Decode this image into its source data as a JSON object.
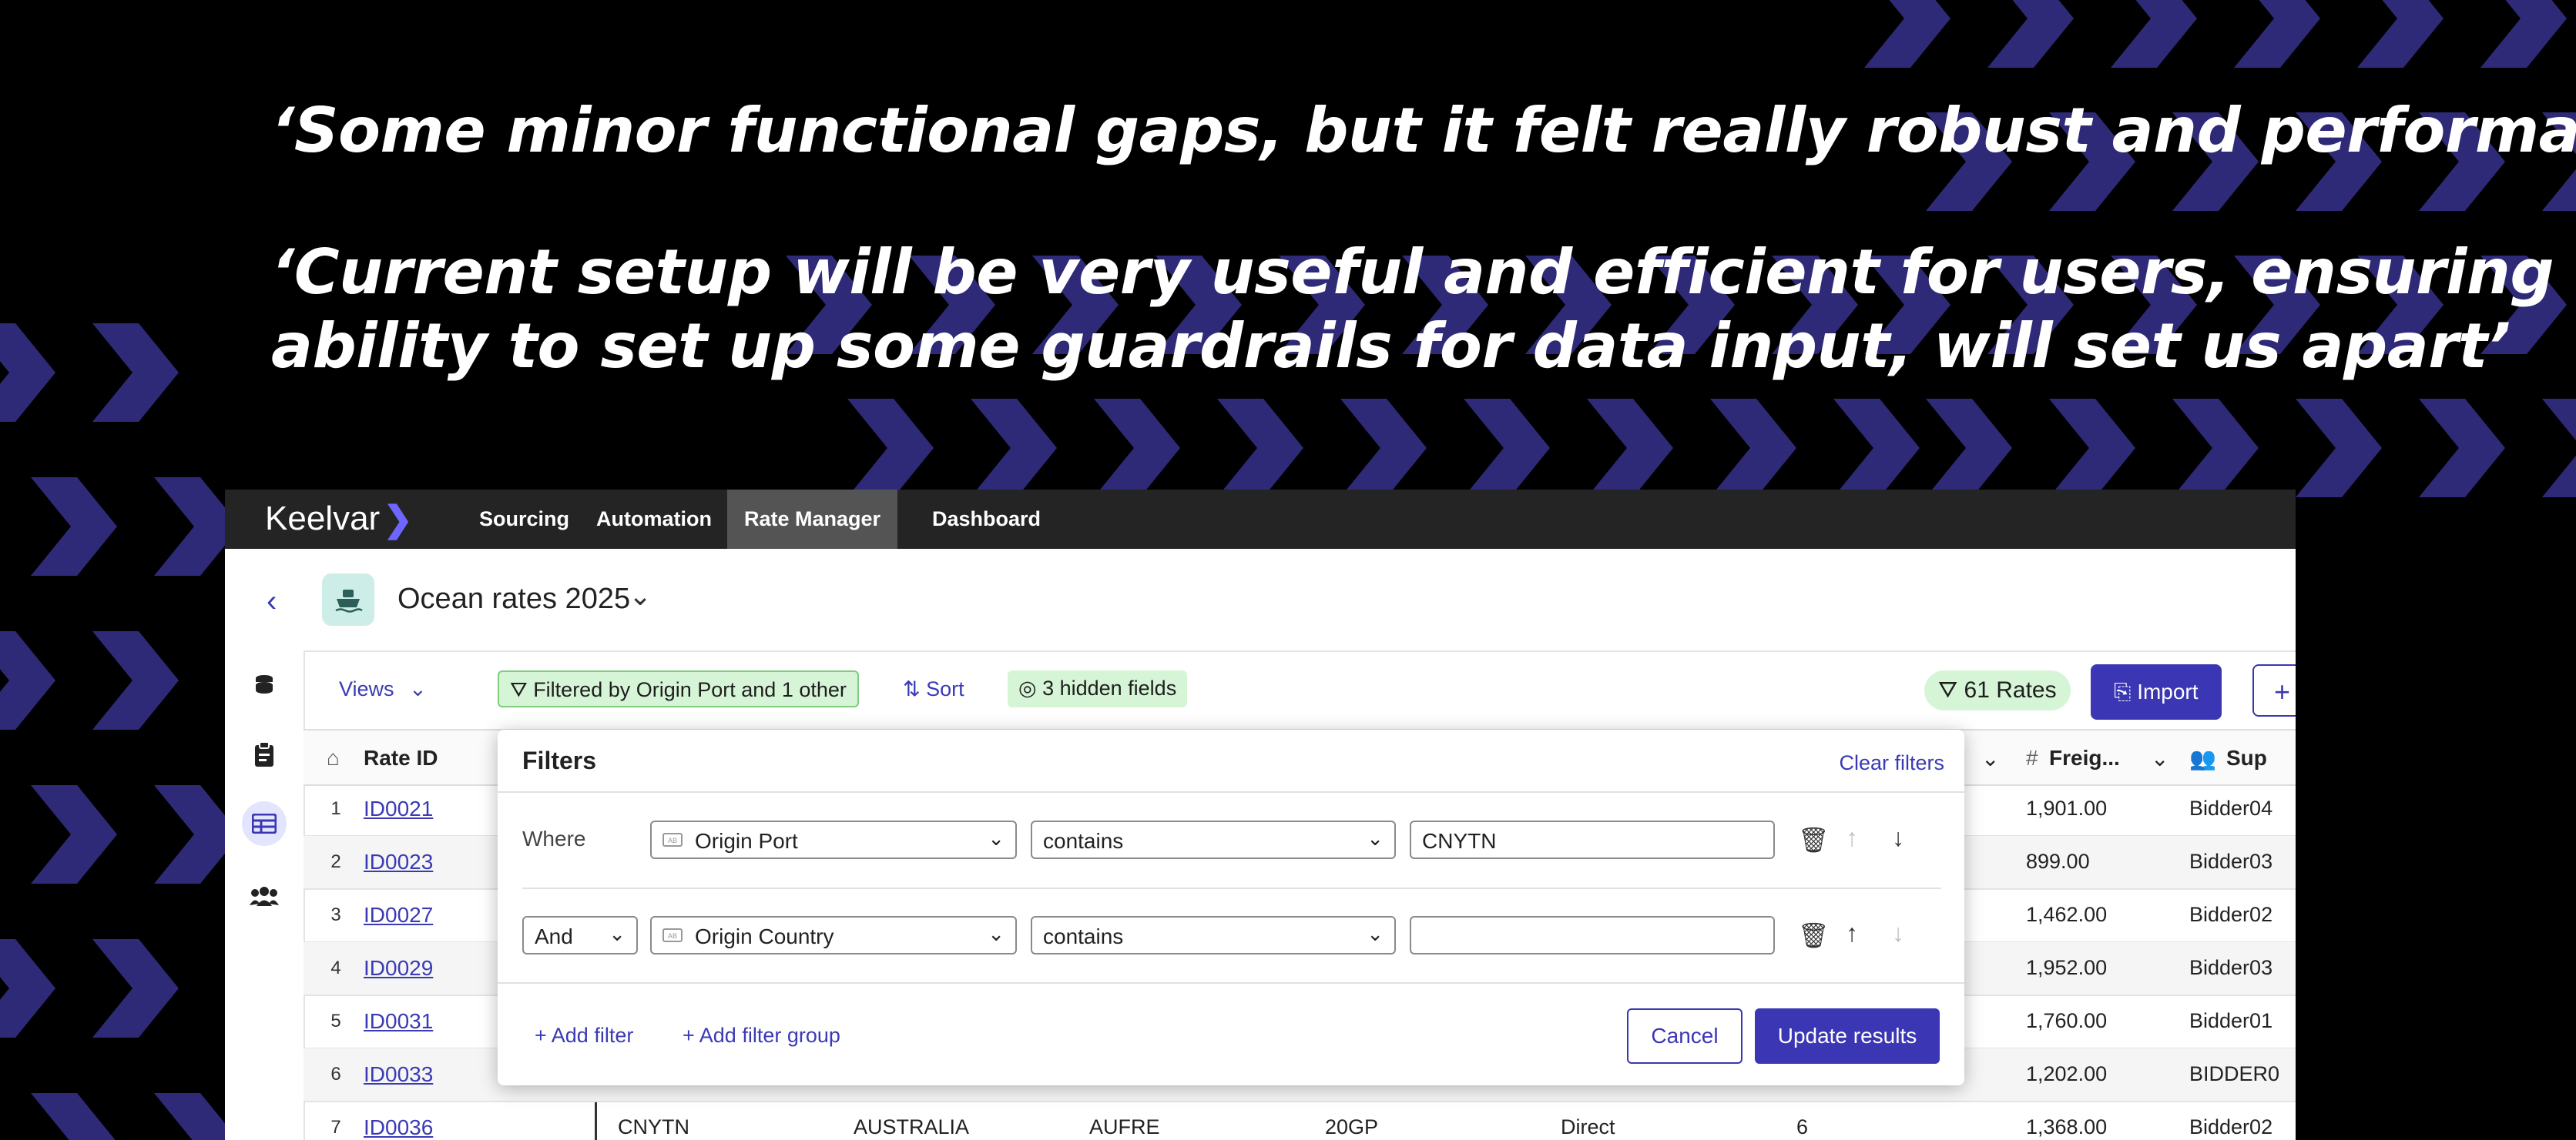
{
  "quotes": [
    "‘Some minor functional gaps, but it felt really robust and performant’",
    "‘Current setup will be very useful and efficient for users, ensuring the ability to set up some guardrails for data input, will set us apart’"
  ],
  "quote_lines": {
    "q2_line1": "‘Current setup will be very useful and efficient for users, ensuring the",
    "q2_line2": "ability to set up some guardrails for data input, will set us apart’"
  },
  "colors": {
    "background": "#000000",
    "chevron": "#2f2a78",
    "accent": "#3b36b3",
    "nav": "#242424"
  },
  "app": {
    "logo": "Keelvar",
    "logo_icon": "chevron-right-icon",
    "nav": [
      "Sourcing",
      "Automation",
      "Rate Manager",
      "Dashboard"
    ],
    "active_nav": "Rate Manager",
    "title": "Ocean rates 2025",
    "toolbar": {
      "views": "Views",
      "filter_chip": "Filtered by Origin Port and 1 other",
      "sort": "Sort",
      "hidden_fields": "3 hidden fields",
      "rates": "61 Rates",
      "import": "Import",
      "plus": "+"
    },
    "columns": {
      "rate_id": "Rate ID",
      "freight": "Freig...",
      "supplier": "Sup"
    },
    "rows": [
      {
        "n": "1",
        "id": "ID0021",
        "freight": "1,901.00",
        "supplier": "Bidder04"
      },
      {
        "n": "2",
        "id": "ID0023",
        "freight": "899.00",
        "supplier": "Bidder03"
      },
      {
        "n": "3",
        "id": "ID0027",
        "freight": "1,462.00",
        "supplier": "Bidder02"
      },
      {
        "n": "4",
        "id": "ID0029",
        "freight": "1,952.00",
        "supplier": "Bidder03"
      },
      {
        "n": "5",
        "id": "ID0031",
        "freight": "1,760.00",
        "supplier": "Bidder01"
      },
      {
        "n": "6",
        "id": "ID0033",
        "freight": "1,202.00",
        "supplier": "BIDDER0"
      },
      {
        "n": "7",
        "id": "ID0036",
        "origin_port": "CNYTN",
        "origin_country": "AUSTRALIA",
        "dest": "AUFRE",
        "equipment": "20GP",
        "routing": "Direct",
        "transit": "6",
        "freight": "1,368.00",
        "supplier": "Bidder02"
      }
    ]
  },
  "filters": {
    "title": "Filters",
    "clear": "Clear filters",
    "row1": {
      "conj": "Where",
      "field": "Origin Port",
      "op": "contains",
      "value": "CNYTN"
    },
    "row2": {
      "conj": "And",
      "field": "Origin Country",
      "op": "contains",
      "value": ""
    },
    "add_filter": "+ Add filter",
    "add_group": "+ Add filter group",
    "cancel": "Cancel",
    "update": "Update results"
  }
}
